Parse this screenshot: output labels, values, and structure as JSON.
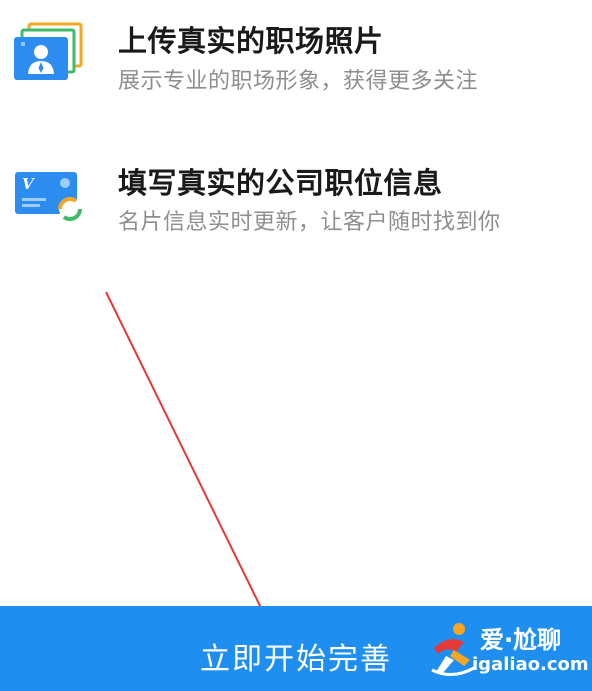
{
  "features": [
    {
      "icon": "profile-photo-stack-icon",
      "title": "上传真实的职场照片",
      "subtitle": "展示专业的职场形象，获得更多关注"
    },
    {
      "icon": "business-card-refresh-icon",
      "title": "填写真实的公司职位信息",
      "subtitle": "名片信息实时更新，让客户随时找到你"
    }
  ],
  "cta": {
    "label": "立即开始完善"
  },
  "watermark": {
    "name": "爱·尬聊",
    "domain": "igaliao.com"
  },
  "colors": {
    "primary": "#1E8FF0",
    "icon_blue": "#2D8CF0",
    "icon_orange": "#F5A623",
    "icon_green": "#3FB96A",
    "annotation_arrow": "#E53935",
    "title_text": "#1A1A1A",
    "subtitle_text": "#8E8E8E"
  }
}
